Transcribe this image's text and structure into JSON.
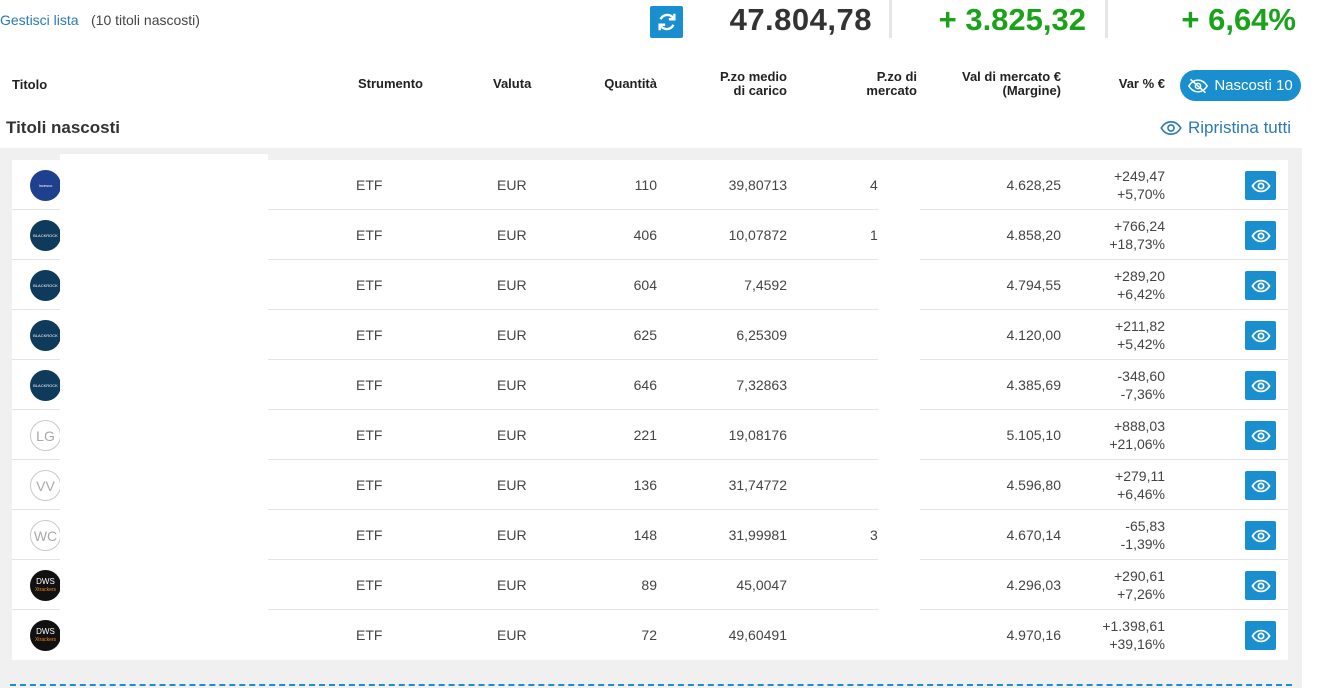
{
  "topbar": {
    "manage_label": "Gestisci lista",
    "hidden_count_label": "(10 titoli nascosti)",
    "total_value": "47.804,78",
    "gain_abs": "+ 3.825,32",
    "gain_pct": "+ 6,64%",
    "refresh_icon": "refresh-icon",
    "colors": {
      "accent": "#1a8fcf",
      "gain": "#1aa21a"
    }
  },
  "headers": {
    "titolo": "Titolo",
    "strumento": "Strumento",
    "valuta": "Valuta",
    "quantita": "Quantità",
    "pmc_line1": "P.zo medio",
    "pmc_line2": "di carico",
    "pm_line1": "P.zo di",
    "pm_line2": "mercato",
    "val_line1": "Val di mercato €",
    "val_line2": "(Margine)",
    "var": "Var % €",
    "hidden_pill": "Nascosti 10"
  },
  "section": {
    "title": "Titoli nascosti",
    "restore_label": "Ripristina tutti"
  },
  "rows": [
    {
      "logo": "invesco",
      "logo_text": "Invesco",
      "strumento": "ETF",
      "valuta": "EUR",
      "quantita": "110",
      "pmc": "39,80713",
      "pm": "4",
      "valore": "4.628,25",
      "var_abs": "+249,47",
      "var_pct": "+5,70%"
    },
    {
      "logo": "blackrock",
      "logo_text": "BLACKROCK",
      "strumento": "ETF",
      "valuta": "EUR",
      "quantita": "406",
      "pmc": "10,07872",
      "pm": "1",
      "valore": "4.858,20",
      "var_abs": "+766,24",
      "var_pct": "+18,73%"
    },
    {
      "logo": "blackrock",
      "logo_text": "BLACKROCK",
      "strumento": "ETF",
      "valuta": "EUR",
      "quantita": "604",
      "pmc": "7,4592",
      "pm": "",
      "valore": "4.794,55",
      "var_abs": "+289,20",
      "var_pct": "+6,42%"
    },
    {
      "logo": "blackrock",
      "logo_text": "BLACKROCK",
      "strumento": "ETF",
      "valuta": "EUR",
      "quantita": "625",
      "pmc": "6,25309",
      "pm": "",
      "valore": "4.120,00",
      "var_abs": "+211,82",
      "var_pct": "+5,42%"
    },
    {
      "logo": "blackrock",
      "logo_text": "BLACKROCK",
      "strumento": "ETF",
      "valuta": "EUR",
      "quantita": "646",
      "pmc": "7,32863",
      "pm": "",
      "valore": "4.385,69",
      "var_abs": "-348,60",
      "var_pct": "-7,36%"
    },
    {
      "logo": "initials",
      "logo_text": "LG",
      "strumento": "ETF",
      "valuta": "EUR",
      "quantita": "221",
      "pmc": "19,08176",
      "pm": "",
      "valore": "5.105,10",
      "var_abs": "+888,03",
      "var_pct": "+21,06%"
    },
    {
      "logo": "initials",
      "logo_text": "VV",
      "strumento": "ETF",
      "valuta": "EUR",
      "quantita": "136",
      "pmc": "31,74772",
      "pm": "",
      "valore": "4.596,80",
      "var_abs": "+279,11",
      "var_pct": "+6,46%"
    },
    {
      "logo": "initials",
      "logo_text": "WC",
      "strumento": "ETF",
      "valuta": "EUR",
      "quantita": "148",
      "pmc": "31,99981",
      "pm": "3",
      "valore": "4.670,14",
      "var_abs": "-65,83",
      "var_pct": "-1,39%"
    },
    {
      "logo": "dws",
      "logo_text": "DWS",
      "logo_sub": "Xtrackers",
      "strumento": "ETF",
      "valuta": "EUR",
      "quantita": "89",
      "pmc": "45,0047",
      "pm": "",
      "valore": "4.296,03",
      "var_abs": "+290,61",
      "var_pct": "+7,26%"
    },
    {
      "logo": "dws",
      "logo_text": "DWS",
      "logo_sub": "Xtrackers",
      "strumento": "ETF",
      "valuta": "EUR",
      "quantita": "72",
      "pmc": "49,60491",
      "pm": "",
      "valore": "4.970,16",
      "var_abs": "+1.398,61",
      "var_pct": "+39,16%"
    }
  ]
}
